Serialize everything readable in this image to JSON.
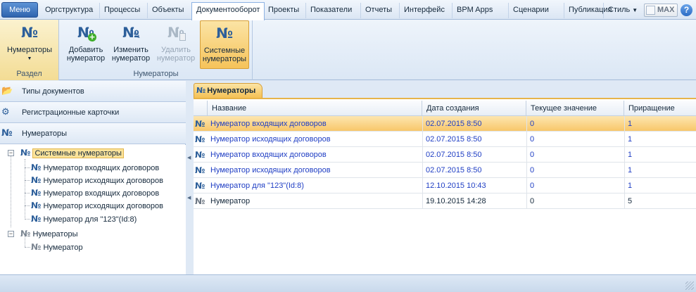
{
  "app": {
    "menu_label": "Меню",
    "max_label": "MAX",
    "help_glyph": "?"
  },
  "tabs": [
    {
      "label": "Оргструктура"
    },
    {
      "label": "Процессы"
    },
    {
      "label": "Объекты"
    },
    {
      "label": "Документооборот",
      "active": true
    },
    {
      "label": "Проекты"
    },
    {
      "label": "Показатели"
    },
    {
      "label": "Отчеты"
    },
    {
      "label": "Интерфейс"
    },
    {
      "label": "BPM Apps"
    },
    {
      "label": "Сценарии"
    },
    {
      "label": "Публикация"
    },
    {
      "label": "Стиль"
    }
  ],
  "ribbon": {
    "icon_glyph": "№",
    "section_group": {
      "caption": "Раздел",
      "button": {
        "line1": "Нумераторы",
        "icon": "numerator-icon"
      }
    },
    "numerators_group": {
      "caption": "Нумераторы",
      "add": {
        "line1": "Добавить",
        "line2": "нумератор",
        "icon": "numerator-add-icon"
      },
      "edit": {
        "line1": "Изменить",
        "line2": "нумератор",
        "icon": "numerator-edit-icon"
      },
      "delete": {
        "line1": "Удалить",
        "line2": "нумератор",
        "icon": "numerator-delete-icon",
        "disabled": true
      },
      "system": {
        "line1": "Системные",
        "line2": "нумераторы",
        "icon": "numerator-system-icon",
        "active": true
      }
    }
  },
  "nav": [
    {
      "label": "Типы документов",
      "icon": "document-types-icon"
    },
    {
      "label": "Регистрационные карточки",
      "icon": "registration-cards-icon"
    },
    {
      "label": "Нумераторы",
      "icon": "numerators-icon"
    }
  ],
  "tree": {
    "glyph": "№",
    "system_root": "Системные нумераторы",
    "system_children": [
      "Нумератор входящих договоров",
      "Нумератор исходящих договоров",
      "Нумератор входящих договоров",
      "Нумератор исходящих договоров",
      "Нумератор для \"123\"(Id:8)"
    ],
    "user_root": "Нумераторы",
    "user_children": [
      "Нумератор"
    ]
  },
  "doc_tab": {
    "label": "Нумераторы"
  },
  "grid": {
    "columns": [
      "Название",
      "Дата создания",
      "Текущее значение",
      "Приращение"
    ],
    "rows": [
      {
        "name": "Нумератор входящих договоров",
        "date": "02.07.2015 8:50",
        "current": "0",
        "increment": "1",
        "system": true,
        "selected": true
      },
      {
        "name": "Нумератор исходящих договоров",
        "date": "02.07.2015 8:50",
        "current": "0",
        "increment": "1",
        "system": true
      },
      {
        "name": "Нумератор входящих договоров",
        "date": "02.07.2015 8:50",
        "current": "0",
        "increment": "1",
        "system": true
      },
      {
        "name": "Нумератор исходящих договоров",
        "date": "02.07.2015 8:50",
        "current": "0",
        "increment": "1",
        "system": true
      },
      {
        "name": "Нумератор для \"123\"(Id:8)",
        "date": "12.10.2015 10:43",
        "current": "0",
        "increment": "1",
        "system": true
      },
      {
        "name": "Нумератор",
        "date": "19.10.2015 14:28",
        "current": "0",
        "increment": "5",
        "system": false
      }
    ]
  },
  "colors": {
    "accent": "#f6c35a",
    "system_text": "#1f3ec4",
    "user_text": "#15293c"
  }
}
